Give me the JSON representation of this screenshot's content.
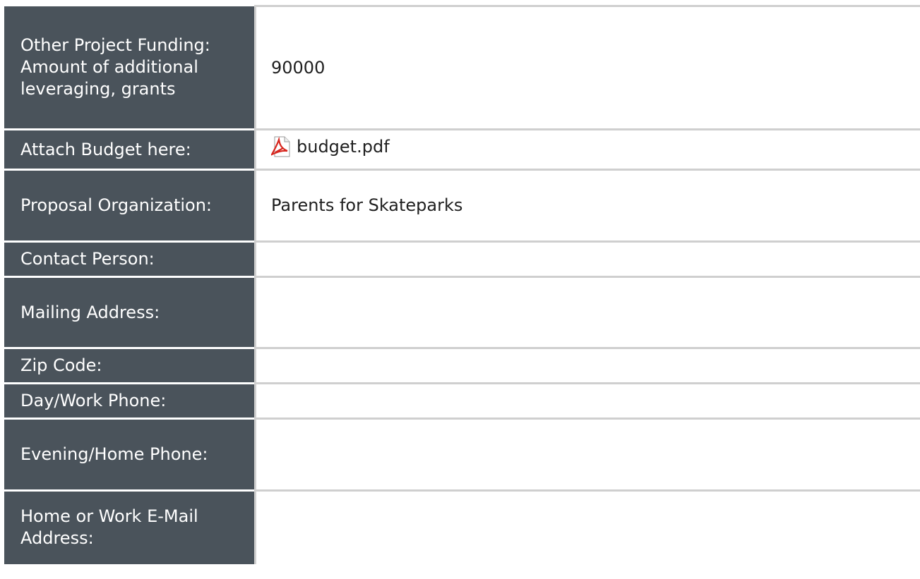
{
  "rows": [
    {
      "label": "Other Project Funding: Amount of additional leveraging, grants",
      "value": "90000"
    },
    {
      "label": "Attach Budget here:",
      "value": "budget.pdf",
      "icon": "pdf-icon"
    },
    {
      "label": "Proposal Organization:",
      "value": "Parents for Skateparks"
    },
    {
      "label": "Contact Person:",
      "value": ""
    },
    {
      "label": "Mailing Address:",
      "value": ""
    },
    {
      "label": "Zip Code:",
      "value": ""
    },
    {
      "label": "Day/Work Phone:",
      "value": ""
    },
    {
      "label": "Evening/Home Phone:",
      "value": ""
    },
    {
      "label": "Home or Work E-Mail Address:",
      "value": ""
    }
  ],
  "colors": {
    "label_background": "#4a535b",
    "label_text": "#ffffff",
    "border": "#cfcfcf",
    "pdf_red": "#d7261e"
  }
}
